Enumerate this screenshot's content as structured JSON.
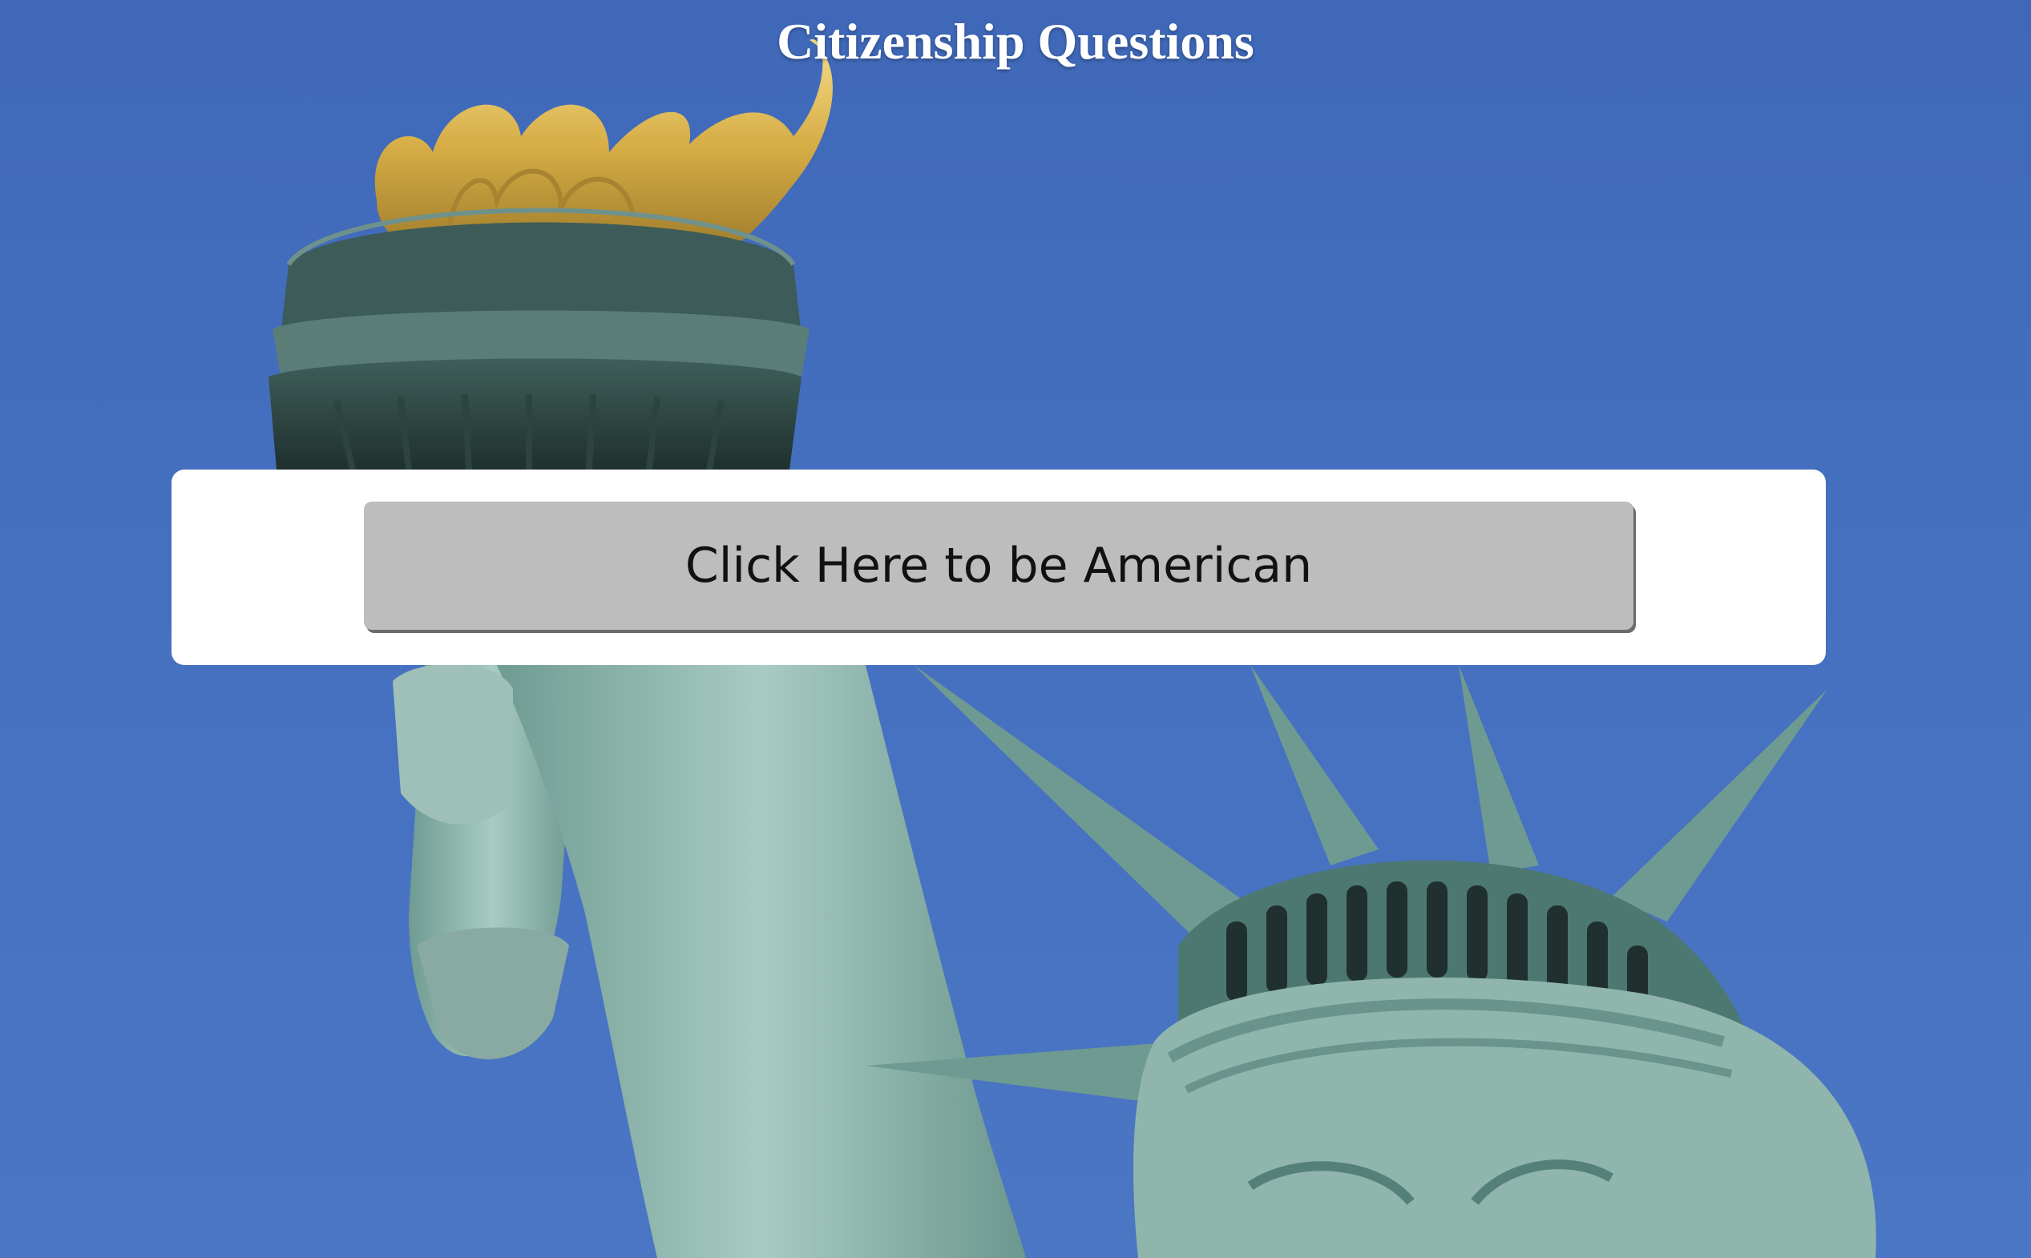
{
  "page": {
    "title": "Citizenship Questions"
  },
  "cta": {
    "button_label": "Click Here to be American"
  },
  "background": {
    "subject": "Statue of Liberty torch and crowned head against blue sky",
    "sky_color": "#4570c0",
    "patina_color": "#8fb5ad",
    "flame_color": "#d9b34a"
  }
}
